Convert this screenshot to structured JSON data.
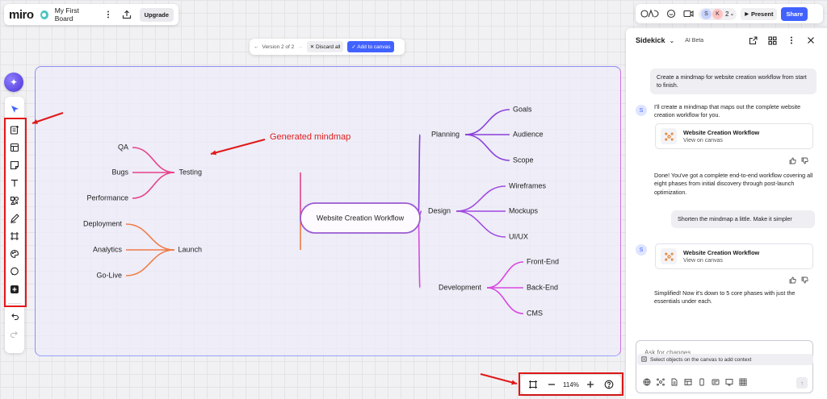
{
  "app": {
    "logo": "miro",
    "board_name": "My First Board",
    "upgrade_label": "Upgrade"
  },
  "header_right": {
    "collaborators": [
      {
        "initial": "S",
        "color": "#c7d3ff"
      },
      {
        "initial": "K",
        "color": "#ffc2c2"
      }
    ],
    "collaborator_count": "2",
    "present_label": "Present",
    "share_label": "Share"
  },
  "version_bar": {
    "version_label": "Version 2 of 2",
    "discard_label": "Discard all",
    "add_label": "Add to canvas"
  },
  "mindmap": {
    "root": "Website Creation Workflow",
    "branches": [
      {
        "label": "Planning",
        "children": [
          "Goals",
          "Audience",
          "Scope"
        ]
      },
      {
        "label": "Design",
        "children": [
          "Wireframes",
          "Mockups",
          "UI/UX"
        ]
      },
      {
        "label": "Development",
        "children": [
          "Front-End",
          "Back-End",
          "CMS"
        ]
      },
      {
        "label": "Testing",
        "children": [
          "QA",
          "Bugs",
          "Performance"
        ]
      },
      {
        "label": "Launch",
        "children": [
          "Deployment",
          "Analytics",
          "Go-Live"
        ]
      }
    ]
  },
  "annotation": {
    "text": "Generated mindmap"
  },
  "zoom": {
    "level": "114%"
  },
  "sidekick": {
    "title": "Sidekick",
    "badge": "AI Beta",
    "user_initial": "S",
    "messages": [
      {
        "role": "user",
        "text": "Create a mindmap for website creation workflow from start to finish."
      },
      {
        "role": "ai",
        "text": "I'll create a mindmap that maps out the complete website creation workflow for you."
      },
      {
        "role": "card",
        "title": "Website Creation Workflow",
        "link": "View on canvas"
      },
      {
        "role": "ai",
        "text": "Done! You've got a complete end-to-end workflow covering all eight phases from initial discovery through post-launch optimization."
      },
      {
        "role": "user",
        "text": "Shorten the mindmap a little. Make it simpler"
      },
      {
        "role": "card",
        "title": "Website Creation Workflow",
        "link": "View on canvas"
      },
      {
        "role": "ai",
        "text": "Simplified! Now it's down to 5 core phases with just the essentials under each."
      }
    ],
    "context_hint": "Select objects on the canvas to add context",
    "input_placeholder": "Ask for changes"
  },
  "colors": {
    "accent": "#4262ff",
    "annotation": "#e01818",
    "planning": "#8a3fd8",
    "design": "#a04ae0",
    "development": "#d84ae0",
    "testing": "#e8408a",
    "launch": "#f07a45"
  }
}
